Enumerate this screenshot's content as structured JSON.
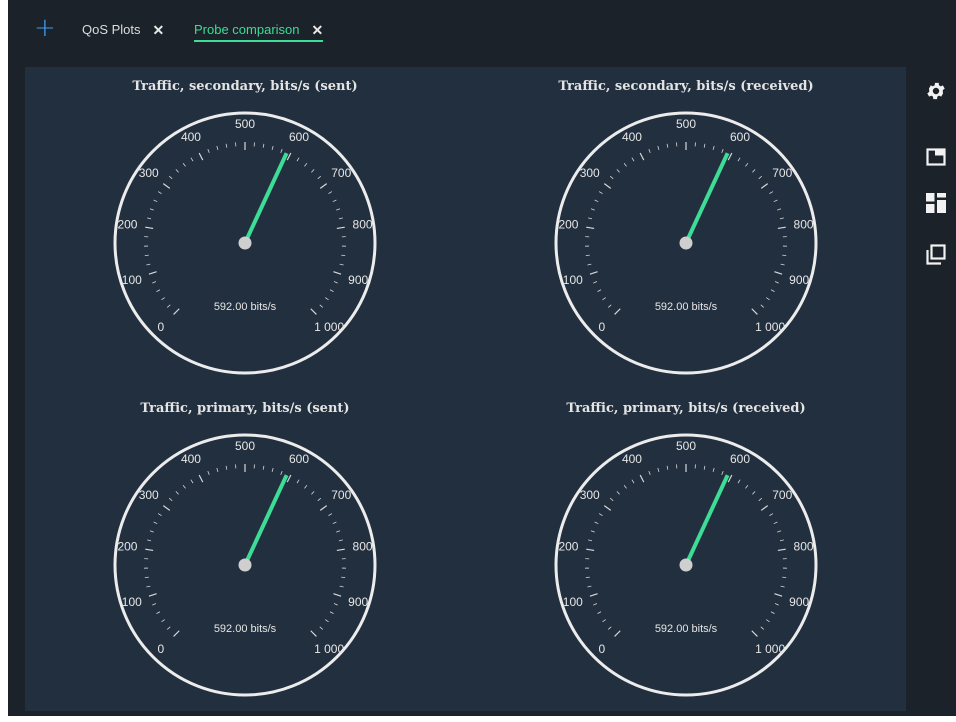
{
  "tabs": [
    {
      "label": "QoS Plots",
      "active": false
    },
    {
      "label": "Probe comparison",
      "active": true
    }
  ],
  "sidebar": {
    "icons": [
      "gear-icon",
      "window-icon",
      "dashboard-layout-icon",
      "duplicate-icon"
    ]
  },
  "gauges": [
    {
      "title": "Traffic, secondary, bits/s (sent)",
      "value": 592,
      "readout": "592.00 bits/s"
    },
    {
      "title": "Traffic, secondary, bits/s (received)",
      "value": 592,
      "readout": "592.00 bits/s"
    },
    {
      "title": "Traffic, primary, bits/s (sent)",
      "value": 592,
      "readout": "592.00 bits/s"
    },
    {
      "title": "Traffic, primary, bits/s (received)",
      "value": 592,
      "readout": "592.00 bits/s"
    }
  ],
  "scale": {
    "min": 0,
    "max": 1000,
    "tick_labels": [
      "0",
      "100",
      "200",
      "300",
      "400",
      "500",
      "600",
      "700",
      "800",
      "900",
      "1 000"
    ]
  },
  "colors": {
    "accent": "#3ddc97",
    "add": "#3d9df5",
    "panel": "#222f3e",
    "background": "#1b2229"
  }
}
